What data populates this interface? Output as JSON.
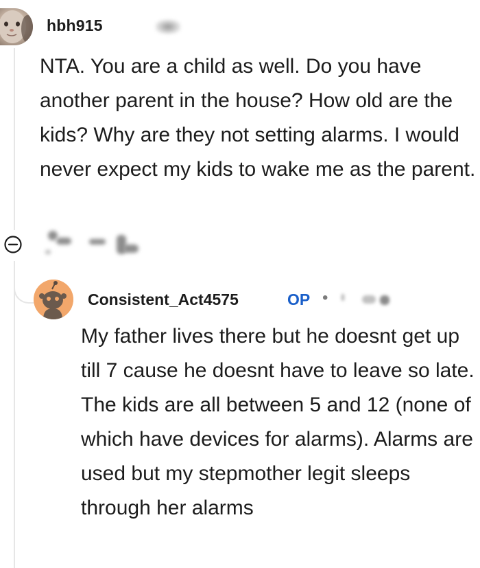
{
  "comment": {
    "username": "hbh915",
    "body": "NTA. You are a child as well. Do you have another parent in the house? How old are the kids? Why are they not setting alarms. I would never expect my kids to wake me as the parent."
  },
  "actions": {
    "collapse_icon": "collapse-minus-icon"
  },
  "reply": {
    "username": "Consistent_Act4575",
    "badge": "OP",
    "separator": "•",
    "body": "My father lives there but he doesnt get up till 7 cause he doesnt have to leave so late. The kids are all between 5 and 12 (none of which have devices for alarms). Alarms are used but my stepmother legit sleeps through her alarms"
  },
  "colors": {
    "op_badge": "#1a5fc9",
    "text": "#1c1c1c",
    "thread_line": "#e6e6e6",
    "reply_avatar_bg": "#f2a76b"
  }
}
